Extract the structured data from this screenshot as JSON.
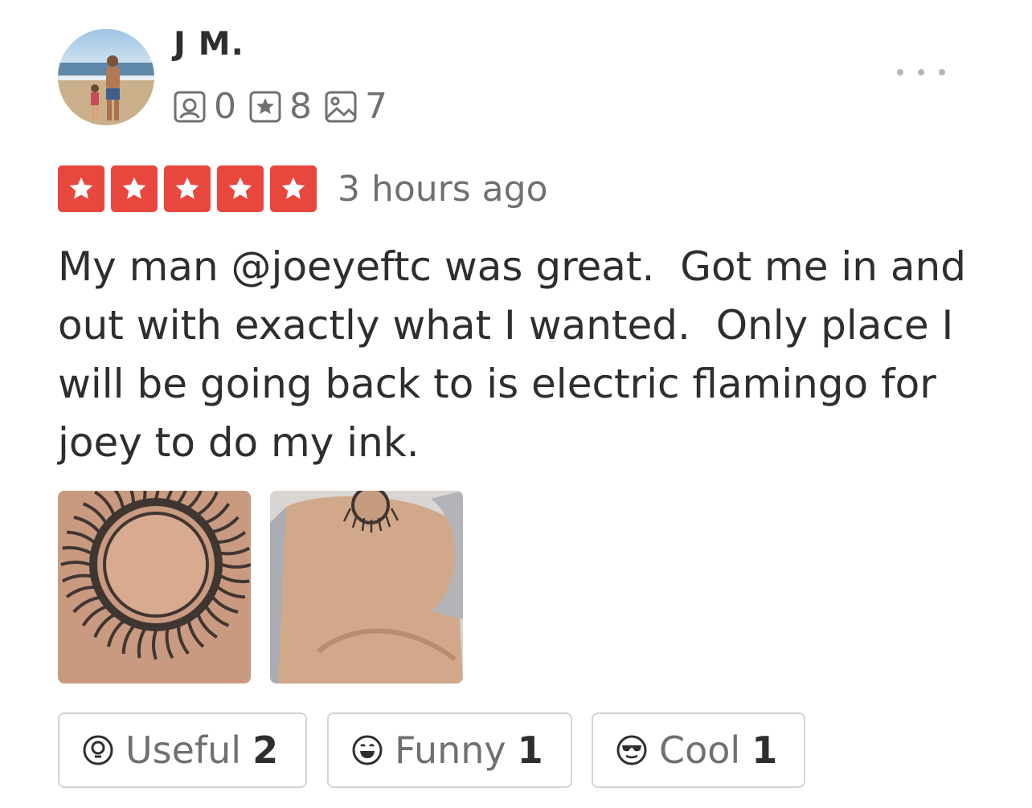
{
  "user": {
    "name": "J M.",
    "friends": "0",
    "reviews": "8",
    "photos": "7"
  },
  "review": {
    "rating": 5,
    "time": "3 hours ago",
    "text": "My man @joeyeftc was great.  Got me in and out with exactly what I wanted.  Only place I will be going back to is electric flamingo for joey to do my ink."
  },
  "reactions": {
    "useful": {
      "label": "Useful",
      "count": "2"
    },
    "funny": {
      "label": "Funny",
      "count": "1"
    },
    "cool": {
      "label": "Cool",
      "count": "1"
    }
  },
  "colors": {
    "star_red": "#e8473d",
    "text_dark": "#2d2e2f",
    "text_gray": "#6e7072",
    "border": "#d3d4d6"
  },
  "icons": [
    "friends-icon",
    "reviews-icon",
    "photos-icon",
    "more-icon",
    "star-icon",
    "useful-icon",
    "funny-icon",
    "cool-icon"
  ]
}
